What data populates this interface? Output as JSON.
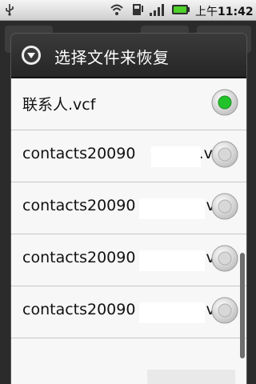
{
  "statusbar": {
    "time_prefix": "上午",
    "time": "11:42",
    "icons": [
      "usb-icon",
      "wifi-icon",
      "sim-icon",
      "signal-icon",
      "battery-icon"
    ]
  },
  "dialog": {
    "title": "选择文件来恢复",
    "header_icon": "chevron-down-circle-icon",
    "items": [
      {
        "label": "联系人.vcf",
        "selected": true
      },
      {
        "label": "contacts20090",
        "tail": "3.v",
        "selected": false
      },
      {
        "label": "contacts20090",
        "tail": ".v",
        "selected": false
      },
      {
        "label": "contacts20090",
        "tail": ".v",
        "selected": false
      },
      {
        "label": "contacts20090",
        "tail": ".v",
        "selected": false
      }
    ]
  },
  "colors": {
    "radio_selected": "#22c22a",
    "header_bg": "#2e2e2e",
    "body_bg": "#f7f7f7"
  }
}
